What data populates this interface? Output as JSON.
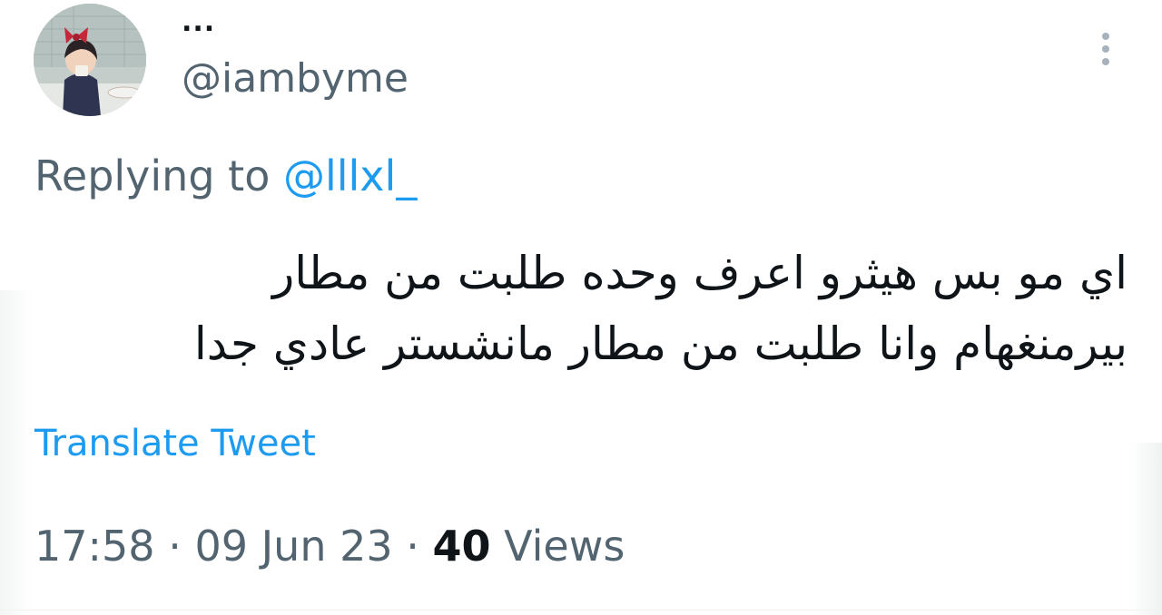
{
  "author": {
    "display_name": "...",
    "handle": "@iambyme"
  },
  "reply": {
    "prefix": "Replying to",
    "mention": "@lllxl_"
  },
  "tweet": {
    "lines": [
      "اي مو بس هيثرو اعرف وحده طلبت من مطار",
      "بيرمنغهام وانا طلبت من مطار مانشستر عادي جدا"
    ]
  },
  "translate_label": "Translate Tweet",
  "meta": {
    "time": "17:58",
    "separator": "·",
    "date": "09 Jun 23",
    "views_count": "40",
    "views_label": "Views"
  },
  "colors": {
    "link": "#1d9bf0",
    "secondary_text": "#536471",
    "primary_text": "#0f1419"
  },
  "icons": {
    "more": "vertical-ellipsis-icon"
  }
}
